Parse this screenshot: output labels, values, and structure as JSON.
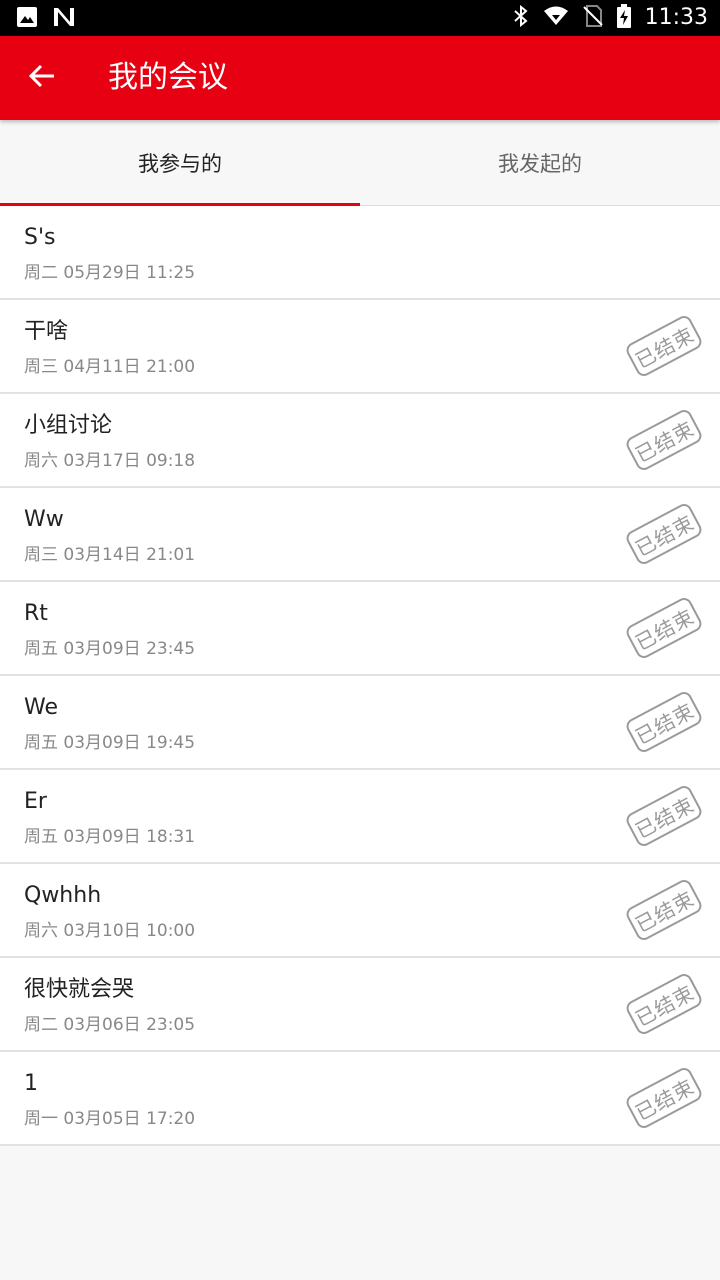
{
  "status_bar": {
    "time": "11:33",
    "left_icons": [
      "image-icon",
      "n-logo-icon"
    ],
    "right_icons": [
      "bluetooth-icon",
      "wifi-icon",
      "no-sim-icon",
      "battery-charging-icon"
    ]
  },
  "app_bar": {
    "title": "我的会议",
    "back_icon": "arrow-left-icon",
    "background": "#e60012"
  },
  "tabs": [
    {
      "label": "我参与的",
      "active": true
    },
    {
      "label": "我发起的",
      "active": false
    }
  ],
  "meetings": [
    {
      "title": "S's",
      "time": "周二 05月29日 11:25",
      "ended": false
    },
    {
      "title": "干啥",
      "time": "周三 04月11日 21:00",
      "ended": true
    },
    {
      "title": "小组讨论",
      "time": "周六 03月17日 09:18",
      "ended": true
    },
    {
      "title": "Ww",
      "time": "周三 03月14日 21:01",
      "ended": true
    },
    {
      "title": "Rt",
      "time": "周五 03月09日 23:45",
      "ended": true
    },
    {
      "title": "We",
      "time": "周五 03月09日 19:45",
      "ended": true
    },
    {
      "title": "Er",
      "time": "周五 03月09日 18:31",
      "ended": true
    },
    {
      "title": "Qwhhh",
      "time": "周六 03月10日 10:00",
      "ended": true
    },
    {
      "title": "很快就会哭",
      "time": "周二 03月06日 23:05",
      "ended": true
    },
    {
      "title": "1",
      "time": "周一 03月05日 17:20",
      "ended": true
    }
  ],
  "ended_stamp_label": "已结束"
}
